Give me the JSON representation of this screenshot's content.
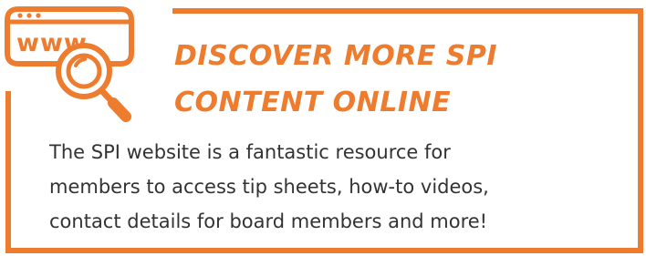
{
  "header": {
    "title_line1": "DISCOVER MORE SPI",
    "title_line2": "CONTENT ONLINE",
    "icon_label": "www",
    "icon": "web-search-icon"
  },
  "body": {
    "line1": "The SPI website is a fantastic resource for",
    "line2": "members to access tip sheets, how-to videos,",
    "line3": "contact details for board members and more!"
  },
  "colors": {
    "accent": "#ee7c2f",
    "text": "#333333",
    "background": "#ffffff"
  }
}
